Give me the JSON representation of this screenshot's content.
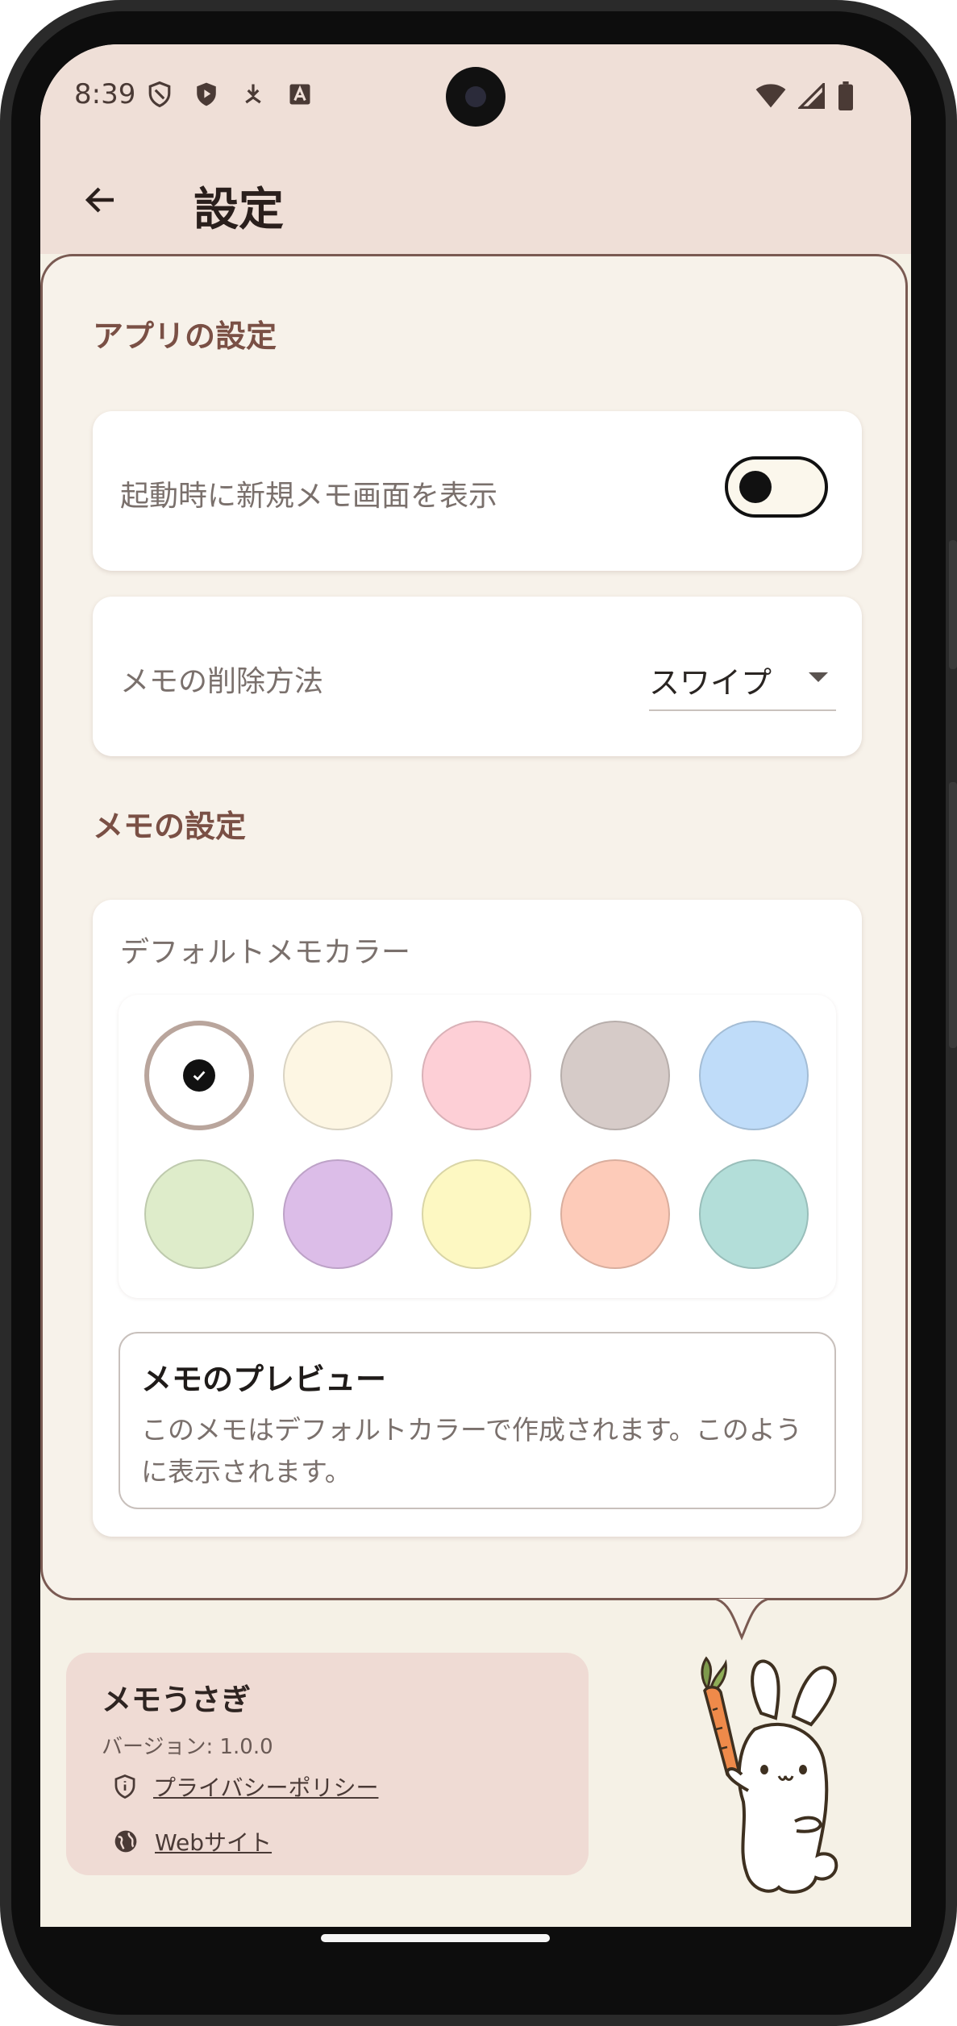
{
  "status_bar": {
    "time": "8:39"
  },
  "app_bar": {
    "title": "設定"
  },
  "sections": {
    "app_settings": {
      "title": "アプリの設定",
      "startup_label": "起動時に新規メモ画面を表示",
      "startup_toggle_on": false,
      "delete_method_label": "メモの削除方法",
      "delete_method_value": "スワイプ"
    },
    "memo_settings": {
      "title": "メモの設定",
      "default_color_label": "デフォルトメモカラー",
      "colors": [
        "#ffffff",
        "#fdf6e3",
        "#fdcfd6",
        "#d6cbc8",
        "#bfdcf9",
        "#deecca",
        "#dcbde8",
        "#fdf8c2",
        "#fdcbb9",
        "#b3ded9"
      ],
      "selected_color_index": 0,
      "preview_title": "メモのプレビュー",
      "preview_body": "このメモはデフォルトカラーで作成されます。このように表示されます。"
    }
  },
  "about": {
    "app_name": "メモうさぎ",
    "version": "バージョン: 1.0.0",
    "privacy_policy": "プライバシーポリシー",
    "website": "Webサイト"
  }
}
